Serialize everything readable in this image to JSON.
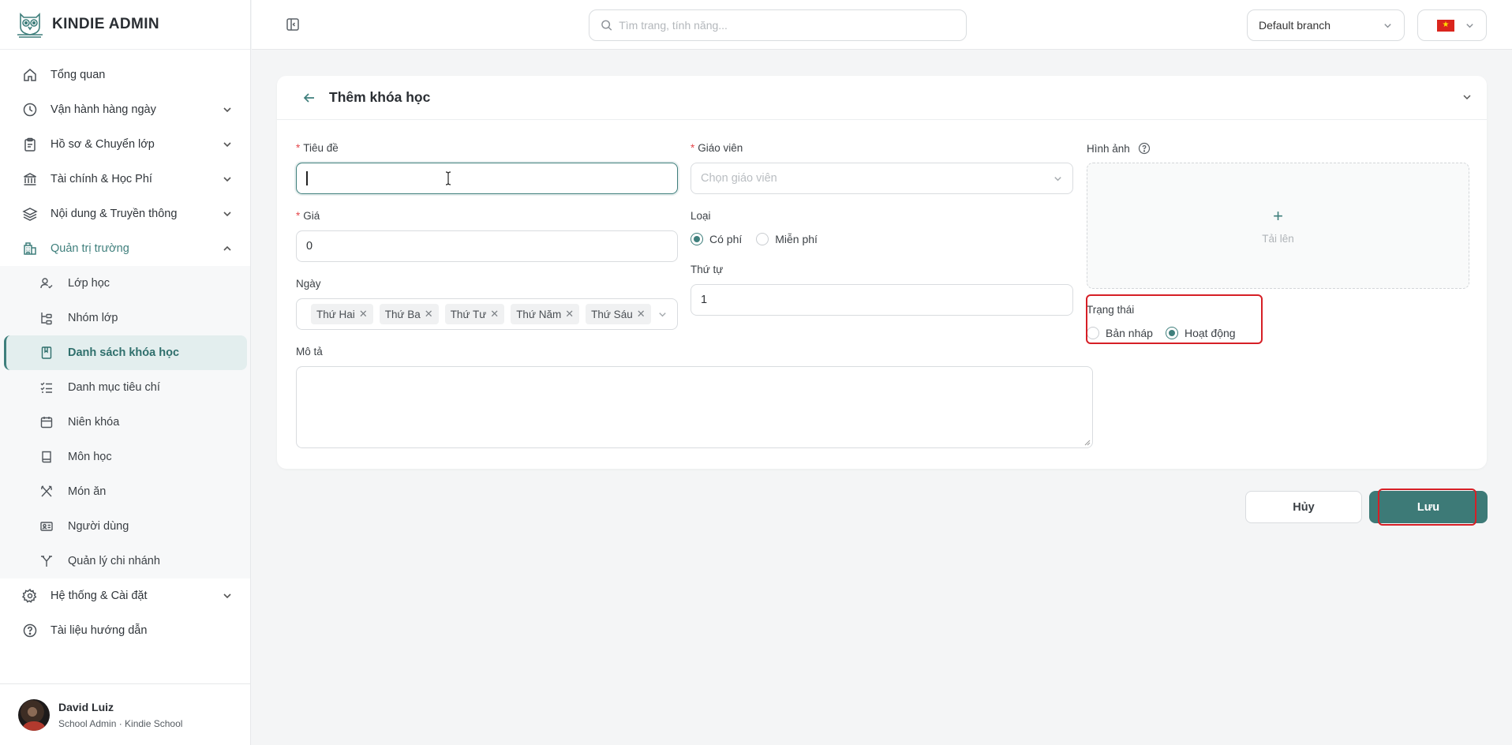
{
  "brand": {
    "name": "KINDIE ADMIN"
  },
  "sidebar": {
    "items": [
      {
        "label": "Tổng quan",
        "icon": "home-icon"
      },
      {
        "label": "Vận hành hàng ngày",
        "icon": "clock-icon"
      },
      {
        "label": "Hồ sơ & Chuyển lớp",
        "icon": "clipboard-icon"
      },
      {
        "label": "Tài chính & Học Phí",
        "icon": "bank-icon"
      },
      {
        "label": "Nội dung & Truyền thông",
        "icon": "layers-icon"
      },
      {
        "label": "Quản trị trường",
        "icon": "building-icon"
      },
      {
        "label": "Hệ thống & Cài đặt",
        "icon": "gear-icon"
      },
      {
        "label": "Tài liệu hướng dẫn",
        "icon": "help-circle-icon"
      }
    ],
    "subitems": [
      {
        "label": "Lớp học",
        "icon": "user-check-icon"
      },
      {
        "label": "Nhóm lớp",
        "icon": "group-tree-icon"
      },
      {
        "label": "Danh sách khóa học",
        "icon": "bookmark-book-icon"
      },
      {
        "label": "Danh mục tiêu chí",
        "icon": "checklist-icon"
      },
      {
        "label": "Niên khóa",
        "icon": "calendar-icon"
      },
      {
        "label": "Môn học",
        "icon": "book-icon"
      },
      {
        "label": "Món ăn",
        "icon": "utensils-icon"
      },
      {
        "label": "Người dùng",
        "icon": "id-card-icon"
      },
      {
        "label": "Quản lý chi nhánh",
        "icon": "branch-icon"
      }
    ]
  },
  "user": {
    "name": "David Luiz",
    "role": "School Admin · Kindie School"
  },
  "topbar": {
    "search_placeholder": "Tìm trang, tính năng...",
    "branch": "Default branch",
    "language": "vi"
  },
  "form": {
    "title": "Thêm khóa học",
    "title_label": "Tiêu đề",
    "title_value": "",
    "teacher_label": "Giáo viên",
    "teacher_placeholder": "Chọn giáo viên",
    "image_label": "Hình ảnh",
    "upload_label": "Tải lên",
    "price_label": "Giá",
    "price_value": "0",
    "type_label": "Loại",
    "type_options": [
      "Có phí",
      "Miễn phí"
    ],
    "type_selected": "Có phí",
    "days_label": "Ngày",
    "days": [
      "Thứ Hai",
      "Thứ Ba",
      "Thứ Tư",
      "Thứ Năm",
      "Thứ Sáu"
    ],
    "order_label": "Thứ tự",
    "order_value": "1",
    "status_label": "Trạng thái",
    "status_options": [
      "Bản nháp",
      "Hoạt động"
    ],
    "status_selected": "Hoạt động",
    "description_label": "Mô tả",
    "description_value": ""
  },
  "actions": {
    "cancel": "Hủy",
    "save": "Lưu"
  },
  "colors": {
    "accent": "#3f7f7c",
    "required": "#e5484d",
    "highlight": "#d61f26"
  }
}
